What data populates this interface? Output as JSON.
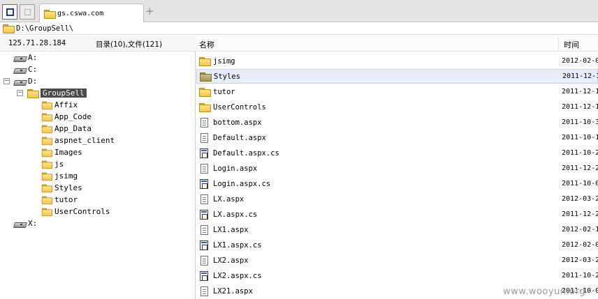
{
  "tab": {
    "title": "gs.cswa.com",
    "add_label": "+"
  },
  "path": "D:\\GroupSell\\",
  "info": {
    "ip": "125.71.28.184",
    "counts": "目录(10),文件(121)"
  },
  "columns": {
    "name": "名称",
    "time": "时间"
  },
  "tree": {
    "drives": [
      {
        "label": "A:"
      },
      {
        "label": "C:"
      },
      {
        "label": "D:"
      },
      {
        "label": "X:"
      }
    ],
    "selected": "GroupSell",
    "children": [
      "Affix",
      "App_Code",
      "App_Data",
      "aspnet_client",
      "Images",
      "js",
      "jsimg",
      "Styles",
      "tutor",
      "UserControls"
    ]
  },
  "files": [
    {
      "name": "jsimg",
      "type": "folder",
      "time": "2012-02-0"
    },
    {
      "name": "Styles",
      "type": "folder-selected",
      "time": "2011-12-1"
    },
    {
      "name": "tutor",
      "type": "folder",
      "time": "2011-12-1"
    },
    {
      "name": "UserControls",
      "type": "folder",
      "time": "2011-12-1"
    },
    {
      "name": "bottom.aspx",
      "type": "doc",
      "time": "2011-10-3"
    },
    {
      "name": "Default.aspx",
      "type": "doc",
      "time": "2011-10-1"
    },
    {
      "name": "Default.aspx.cs",
      "type": "code",
      "time": "2011-10-2"
    },
    {
      "name": "Login.aspx",
      "type": "doc",
      "time": "2011-12-2"
    },
    {
      "name": "Login.aspx.cs",
      "type": "code",
      "time": "2011-10-0"
    },
    {
      "name": "LX.aspx",
      "type": "doc",
      "time": "2012-03-2"
    },
    {
      "name": "LX.aspx.cs",
      "type": "code",
      "time": "2011-12-2"
    },
    {
      "name": "LX1.aspx",
      "type": "doc",
      "time": "2012-02-1"
    },
    {
      "name": "LX1.aspx.cs",
      "type": "code",
      "time": "2012-02-0"
    },
    {
      "name": "LX2.aspx",
      "type": "doc",
      "time": "2012-03-2"
    },
    {
      "name": "LX2.aspx.cs",
      "type": "code",
      "time": "2011-10-2"
    },
    {
      "name": "LX21.aspx",
      "type": "doc",
      "time": "2011-10-0"
    }
  ],
  "watermark": "www.wooyun.org",
  "icons": {
    "folder": "folder-icon",
    "doc": "document-icon",
    "code": "code-file-icon",
    "drive": "drive-icon"
  },
  "colors": {
    "selected_row": "#e7eefa",
    "selected_tree": "#4a4a4a",
    "folder": "#f1c54a"
  }
}
